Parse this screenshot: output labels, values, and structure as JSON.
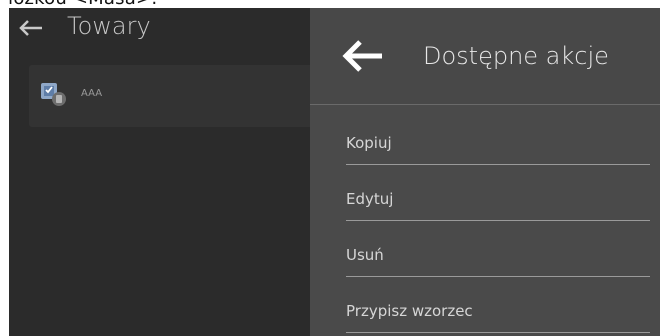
{
  "caption": {
    "text": "łożkou <Masa>:"
  },
  "background_screen": {
    "back_icon": "arrow-left-icon",
    "title": "Towary",
    "products": [
      {
        "name": "AAA",
        "icon": "product-scale-icon"
      }
    ]
  },
  "actions_panel": {
    "back_icon": "arrow-left-icon",
    "title": "Dostępne akcje",
    "items": [
      {
        "label": "Kopiuj"
      },
      {
        "label": "Edytuj"
      },
      {
        "label": "Usuń"
      },
      {
        "label": "Przypisz wzorzec"
      }
    ]
  },
  "colors": {
    "device_bg": "#2b2b2b",
    "panel_bg": "#4a4a4a",
    "text_light": "#e8e8e8",
    "divider": "#9a9a9a"
  }
}
